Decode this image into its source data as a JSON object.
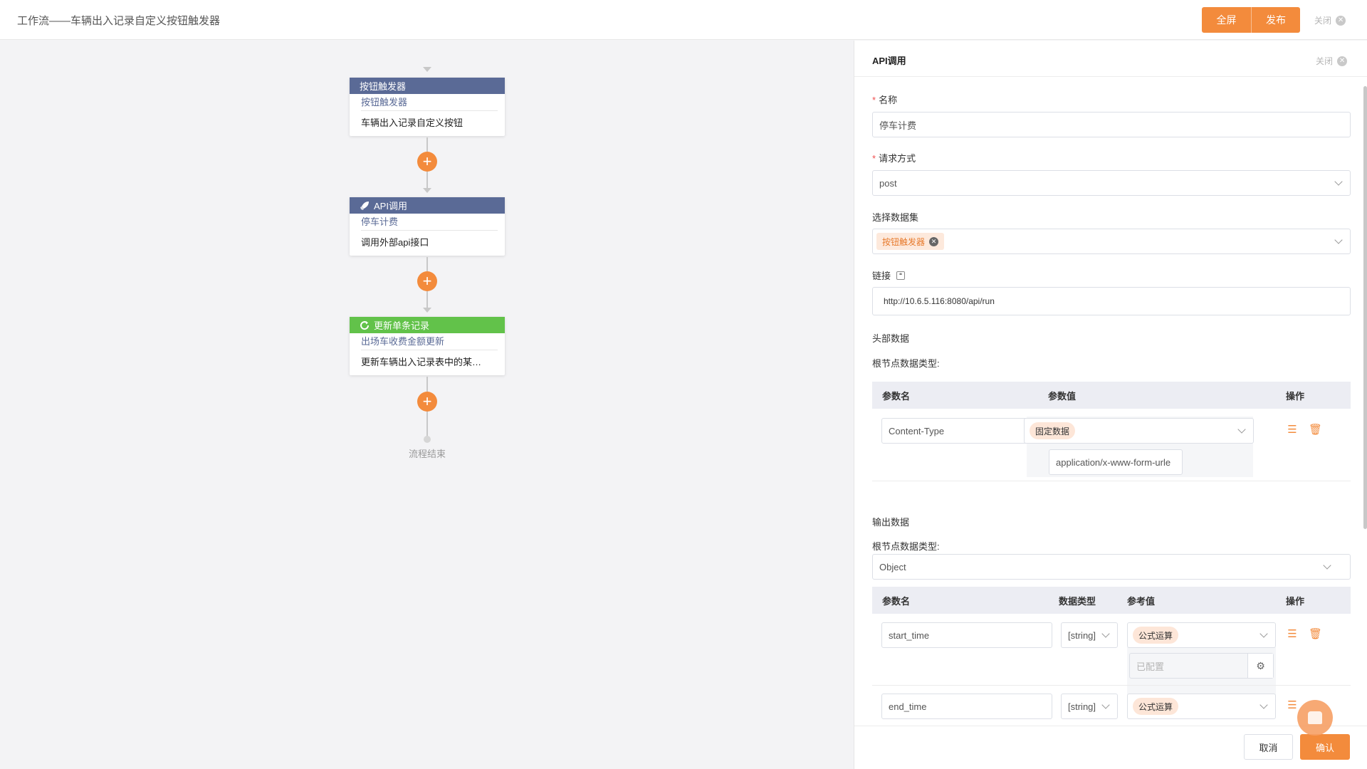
{
  "header": {
    "title": "工作流——车辆出入记录自定义按钮触发器",
    "fullscreen_label": "全屏",
    "publish_label": "发布",
    "close_label": "关闭"
  },
  "flow": {
    "nodes": [
      {
        "head": "按钮触发器",
        "sub": "按钮触发器",
        "desc": "车辆出入记录自定义按钮",
        "icon": "none"
      },
      {
        "head": "API调用",
        "sub": "停车计费",
        "desc": "调用外部api接口",
        "icon": "rocket-icon"
      },
      {
        "head": "更新单条记录",
        "sub": "出场车收费金额更新",
        "desc": "更新车辆出入记录表中的某…",
        "icon": "refresh-icon"
      }
    ],
    "end_label": "流程结束",
    "colors": {
      "blue": "#5a6a96",
      "green": "#62c24a",
      "accent": "#f38b3c"
    }
  },
  "panel": {
    "title": "API调用",
    "close_label": "关闭",
    "name_label": "名称",
    "name_value": "停车计费",
    "method_label": "请求方式",
    "method_value": "post",
    "dataset_label": "选择数据集",
    "dataset_tag": "按钮触发器",
    "link_label": "链接",
    "link_value": "http://10.6.5.116:8080/api/run",
    "headers_label": "头部数据",
    "root_type_label": "根节点数据类型:",
    "headers_table": {
      "col_name": "参数名",
      "col_value": "参数值",
      "col_op": "操作",
      "rows": [
        {
          "name": "Content-Type",
          "value_type": "固定数据",
          "value": "application/x-www-form-urle"
        }
      ]
    },
    "output_label": "输出数据",
    "output_root_type_label": "根节点数据类型:",
    "output_root_type_value": "Object",
    "output_table": {
      "col_name": "参数名",
      "col_type": "数据类型",
      "col_ref": "参考值",
      "col_op": "操作",
      "rows": [
        {
          "name": "start_time",
          "type": "[string]",
          "ref_type": "公式运算",
          "ref_status": "已配置"
        },
        {
          "name": "end_time",
          "type": "[string]",
          "ref_type": "公式运算"
        }
      ]
    },
    "cancel_label": "取消",
    "confirm_label": "确认"
  }
}
